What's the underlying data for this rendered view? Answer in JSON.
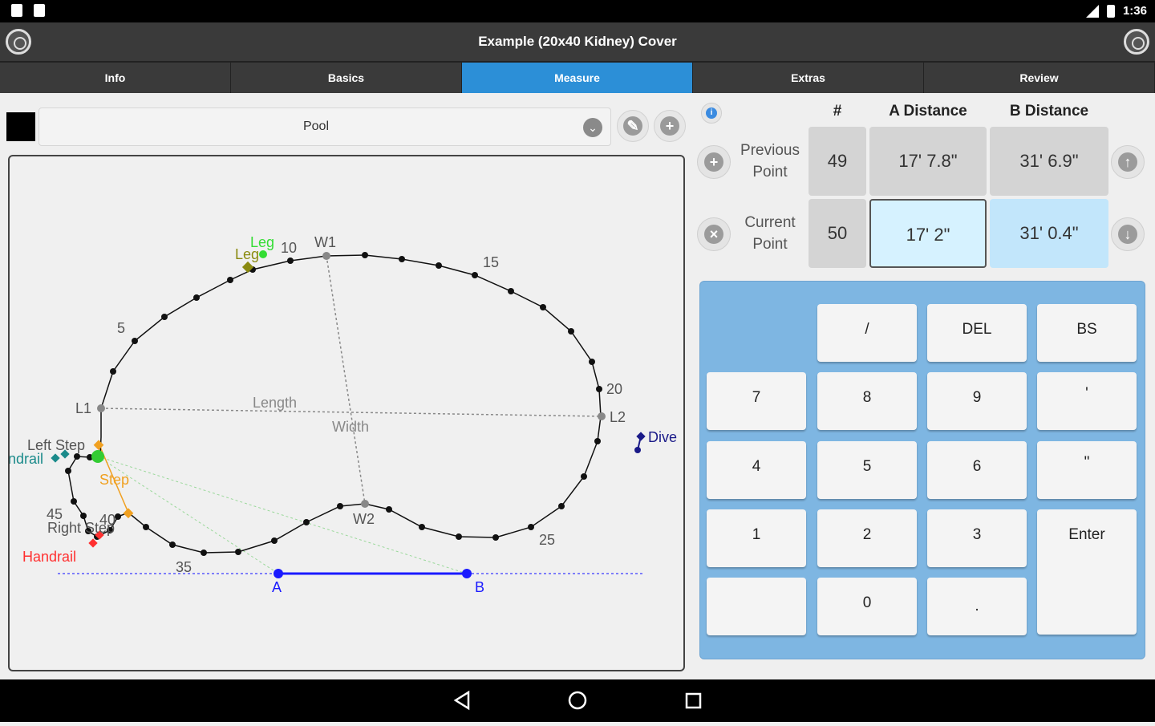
{
  "status": {
    "time": "1:36"
  },
  "app": {
    "title": "Example (20x40 Kidney) Cover"
  },
  "tabs": [
    {
      "label": "Info"
    },
    {
      "label": "Basics"
    },
    {
      "label": "Measure"
    },
    {
      "label": "Extras"
    },
    {
      "label": "Review"
    }
  ],
  "active_tab": "Measure",
  "selector": {
    "selected": "Pool",
    "swatch_color": "#000000"
  },
  "table": {
    "headers": {
      "num": "#",
      "a": "A Distance",
      "b": "B Distance"
    },
    "previous": {
      "label_1": "Previous",
      "label_2": "Point",
      "num": "49",
      "a": "17' 7.8\"",
      "b": "31' 6.9\""
    },
    "current": {
      "label_1": "Current",
      "label_2": "Point",
      "num": "50",
      "a": "17' 2\"",
      "b": "31' 0.4\""
    }
  },
  "keypad": {
    "keys": [
      "/",
      "DEL",
      "BS",
      "7",
      "8",
      "9",
      "'",
      "4",
      "5",
      "6",
      "\"",
      "1",
      "2",
      "3",
      "Enter",
      "0",
      "."
    ]
  },
  "drawing": {
    "labels": {
      "leg_top": "Leg",
      "leg_bottom": "Leg",
      "w1": "W1",
      "w2": "W2",
      "l1": "L1",
      "l2": "L2",
      "length": "Length",
      "width": "Width",
      "n5": "5",
      "n10": "10",
      "n15": "15",
      "n20": "20",
      "n25": "25",
      "n35": "35",
      "n40": "40",
      "n45": "45",
      "dive": "Dive",
      "left_step": "Left Step",
      "handrail_left": "ndrail",
      "step": "Step",
      "right_step": "Right Step",
      "handrail": "Handrail",
      "a": "A",
      "b": "B"
    },
    "colors": {
      "outline": "#111111",
      "guide": "#888888",
      "baseline": "#1a1aff",
      "leg_green": "#33dd33",
      "leg_olive": "#8a8a10",
      "step_orange": "#f0a020",
      "handrail_red": "#ff3030",
      "dive_navy": "#1a1a88",
      "teal": "#1a8a8a"
    }
  }
}
